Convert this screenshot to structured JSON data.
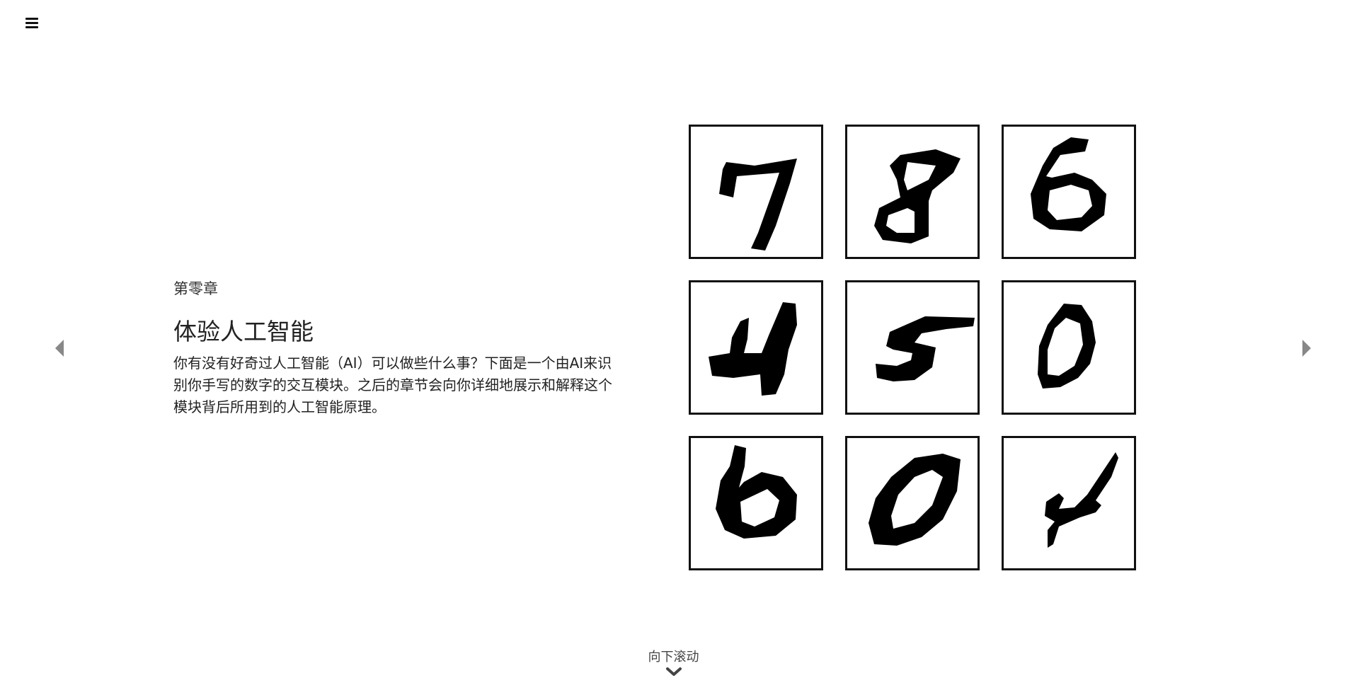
{
  "header": {
    "menu_icon": "hamburger-menu-icon"
  },
  "navigation": {
    "prev_icon": "triangle-left-icon",
    "next_icon": "triangle-right-icon",
    "arrow_color": "#888888"
  },
  "intro": {
    "chapter": "第零章",
    "title": "体验人工智能",
    "description": "你有没有好奇过人工智能（AI）可以做些什么事？下面是一个由AI来识别你手写的数字的交互模块。之后的章节会向你详细地展示和解释这个模块背后所用到的人工智能原理。"
  },
  "digit_grid": {
    "digits": [
      "7",
      "8",
      "6",
      "4",
      "5",
      "0",
      "6",
      "0",
      "4"
    ]
  },
  "footer": {
    "scroll_label": "向下滚动",
    "scroll_icon": "chevron-down-icon"
  }
}
